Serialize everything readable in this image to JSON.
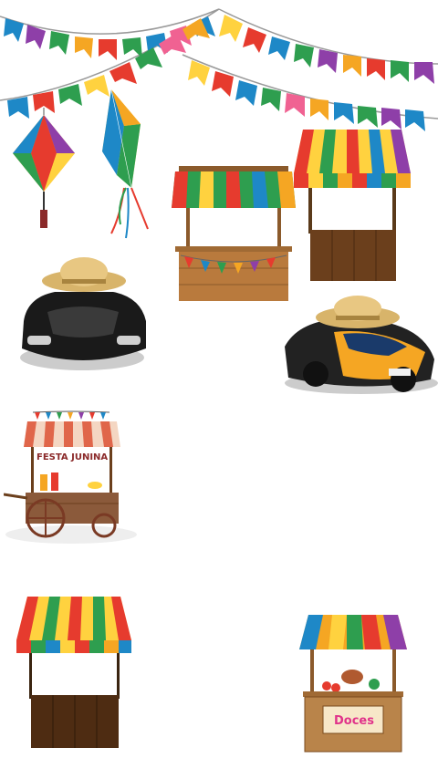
{
  "scene": {
    "background": "#ffffff",
    "bunting_colors": [
      "#e63b2e",
      "#f5a623",
      "#2e9e4f",
      "#1e88c7",
      "#8e3fa8",
      "#f06292",
      "#ffd23f"
    ],
    "items": [
      {
        "name": "bunting-top",
        "icon": "bunting-flags"
      },
      {
        "name": "balloon-lantern-left",
        "icon": "paper-lantern"
      },
      {
        "name": "balloon-lantern-right",
        "icon": "paper-lantern"
      },
      {
        "name": "striped-stall-center",
        "icon": "market-stall"
      },
      {
        "name": "striped-stall-top-right",
        "icon": "market-stall"
      },
      {
        "name": "black-car-with-straw-hat",
        "icon": "sports-car"
      },
      {
        "name": "orange-car-with-straw-hat",
        "icon": "sports-car"
      },
      {
        "name": "festa-junina-cart",
        "icon": "food-cart"
      },
      {
        "name": "striped-stall-bottom-left",
        "icon": "market-stall"
      },
      {
        "name": "doces-stall",
        "icon": "sweets-stall"
      }
    ]
  },
  "cart": {
    "sign": "FESTA JUNINA"
  },
  "doces_stall": {
    "sign": "Doces"
  }
}
